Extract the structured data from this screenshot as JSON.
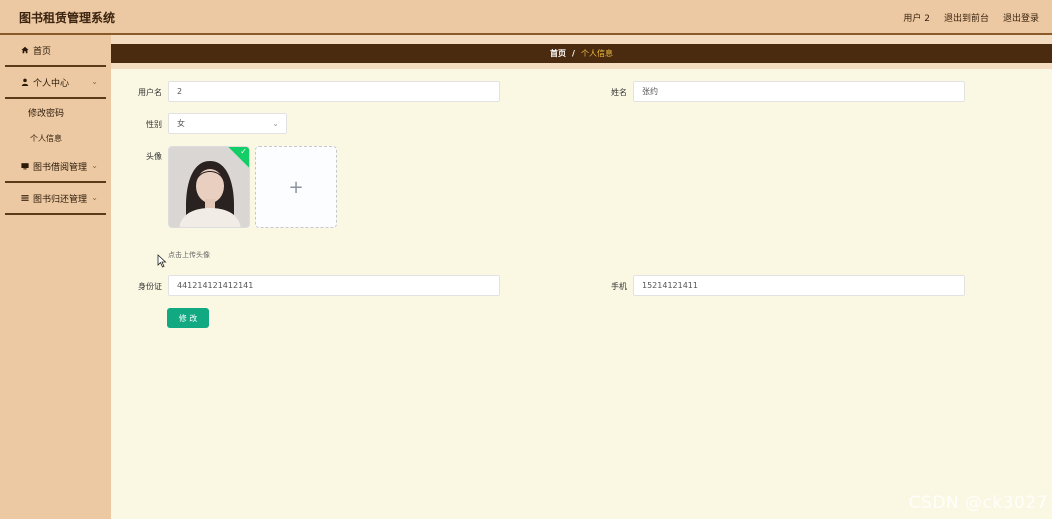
{
  "header": {
    "title": "图书租赁管理系统",
    "user": "用户 2",
    "back_front": "退出到前台",
    "logout": "退出登录"
  },
  "sidebar": {
    "home": "首页",
    "personal_center": "个人中心",
    "change_password": "修改密码",
    "personal_info": "个人信息",
    "borrow_manage": "图书借阅管理",
    "return_manage": "图书归还管理"
  },
  "breadcrumb": {
    "home": "首页",
    "separator": "/",
    "current": "个人信息"
  },
  "form": {
    "username_label": "用户名",
    "username_value": "2",
    "name_label": "姓名",
    "name_value": "张约",
    "gender_label": "性别",
    "gender_value": "女",
    "avatar_label": "头像",
    "upload_hint": "点击上传头像",
    "idcard_label": "身份证",
    "idcard_value": "441214121412141",
    "phone_label": "手机",
    "phone_value": "15214121411",
    "submit": "修 改"
  },
  "watermark": "CSDN @ck3027",
  "colors": {
    "header": "#ecc9a2",
    "breadcrumb_bar": "#4a2b10",
    "breadcrumb_current": "#f0c040",
    "content_bg": "#faf8e3",
    "submit": "#10a982"
  }
}
